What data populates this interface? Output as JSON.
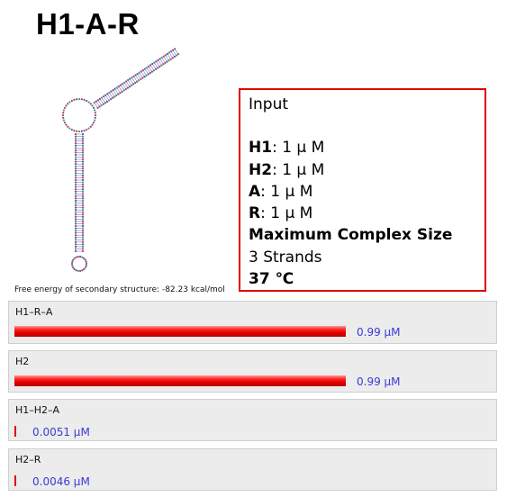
{
  "title": "H1-A-R",
  "free_energy_text": "Free energy of secondary structure: -82.23 kcal/mol",
  "input": {
    "heading": "Input",
    "conditions": [
      {
        "name": "H1",
        "value": ": 1 μ M"
      },
      {
        "name": "H2",
        "value": ": 1 μ M"
      },
      {
        "name": "A",
        "value": ": 1 μ M"
      },
      {
        "name": "R",
        "value": ": 1 μ M"
      }
    ],
    "max_complex_label": "Maximum Complex Size",
    "max_complex_value": "3 Strands",
    "temperature": "37 ℃"
  },
  "complexes": [
    {
      "name": "H1–R–A",
      "concentration": "0.99 μM",
      "fraction": 0.99
    },
    {
      "name": "H2",
      "concentration": "0.99 μM",
      "fraction": 0.99
    },
    {
      "name": "H1–H2–A",
      "concentration": "0.0051 μM",
      "fraction": 0.0051
    },
    {
      "name": "H2–R",
      "concentration": "0.0046 μM",
      "fraction": 0.0046
    }
  ],
  "colors": {
    "box_border": "#e00000",
    "bar": "#e60000",
    "value_text": "#3a3ad6",
    "panel_bg": "#ececec"
  }
}
